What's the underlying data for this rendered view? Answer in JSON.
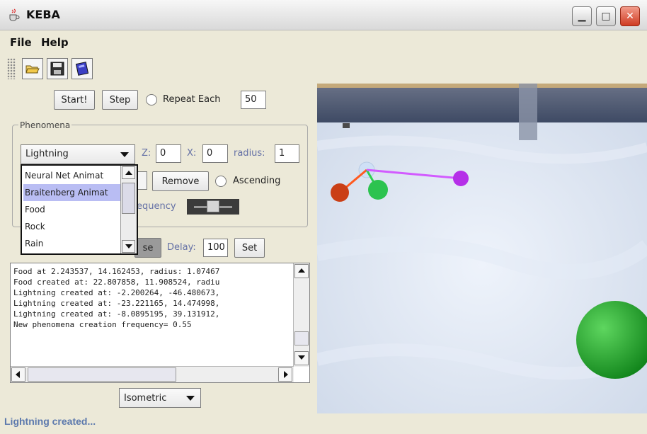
{
  "window": {
    "title": "KEBA"
  },
  "menu": {
    "items": [
      "File",
      "Help"
    ]
  },
  "toolbar": {
    "icons": [
      "open-folder-icon",
      "save-icon",
      "book-icon"
    ]
  },
  "controls": {
    "start_label": "Start!",
    "step_label": "Step",
    "repeat_label": "Repeat Each",
    "repeat_value": "50"
  },
  "phenomena": {
    "group_title": "Phenomena",
    "selected_type": "Lightning",
    "z_label": "Z:",
    "z_value": "0",
    "x_label": "X:",
    "x_value": "0",
    "radius_label": "radius:",
    "radius_value": "1",
    "remove_label": "Remove",
    "ascending_label": "Ascending",
    "frequency_label": "equency",
    "dropdown_items": [
      "Neural Net Animat",
      "Braitenberg Animat",
      "Food",
      "Rock",
      "Rain"
    ],
    "dropdown_selected_index": 1
  },
  "playback": {
    "pause_fragment": "se",
    "delay_label": "Delay:",
    "delay_value": "100",
    "set_label": "Set"
  },
  "log": {
    "lines": [
      "Food at 2.243537, 14.162453, radius: 1.07467",
      "Food created at: 22.807858, 11.908524, radiu",
      "Lightning created at: -2.200264, -46.480673,",
      "Lightning created at: -23.221165, 14.474998,",
      "Lightning created at: -8.0895195, 39.131912,",
      "New phenomena creation frequency= 0.55"
    ]
  },
  "view": {
    "mode": "Isometric"
  },
  "status": {
    "text": "Lightning created..."
  },
  "colors": {
    "floor": "#d9e2ef",
    "wall": "#4d5a75",
    "animat_head": "#c7d8f0",
    "animat_links": [
      "#ff5a1f",
      "#2cd04e",
      "#d25bff"
    ],
    "sphere_green": "#1ea822",
    "dropdown_selected": "#b9bdf3",
    "status_text": "#5c79ad"
  }
}
